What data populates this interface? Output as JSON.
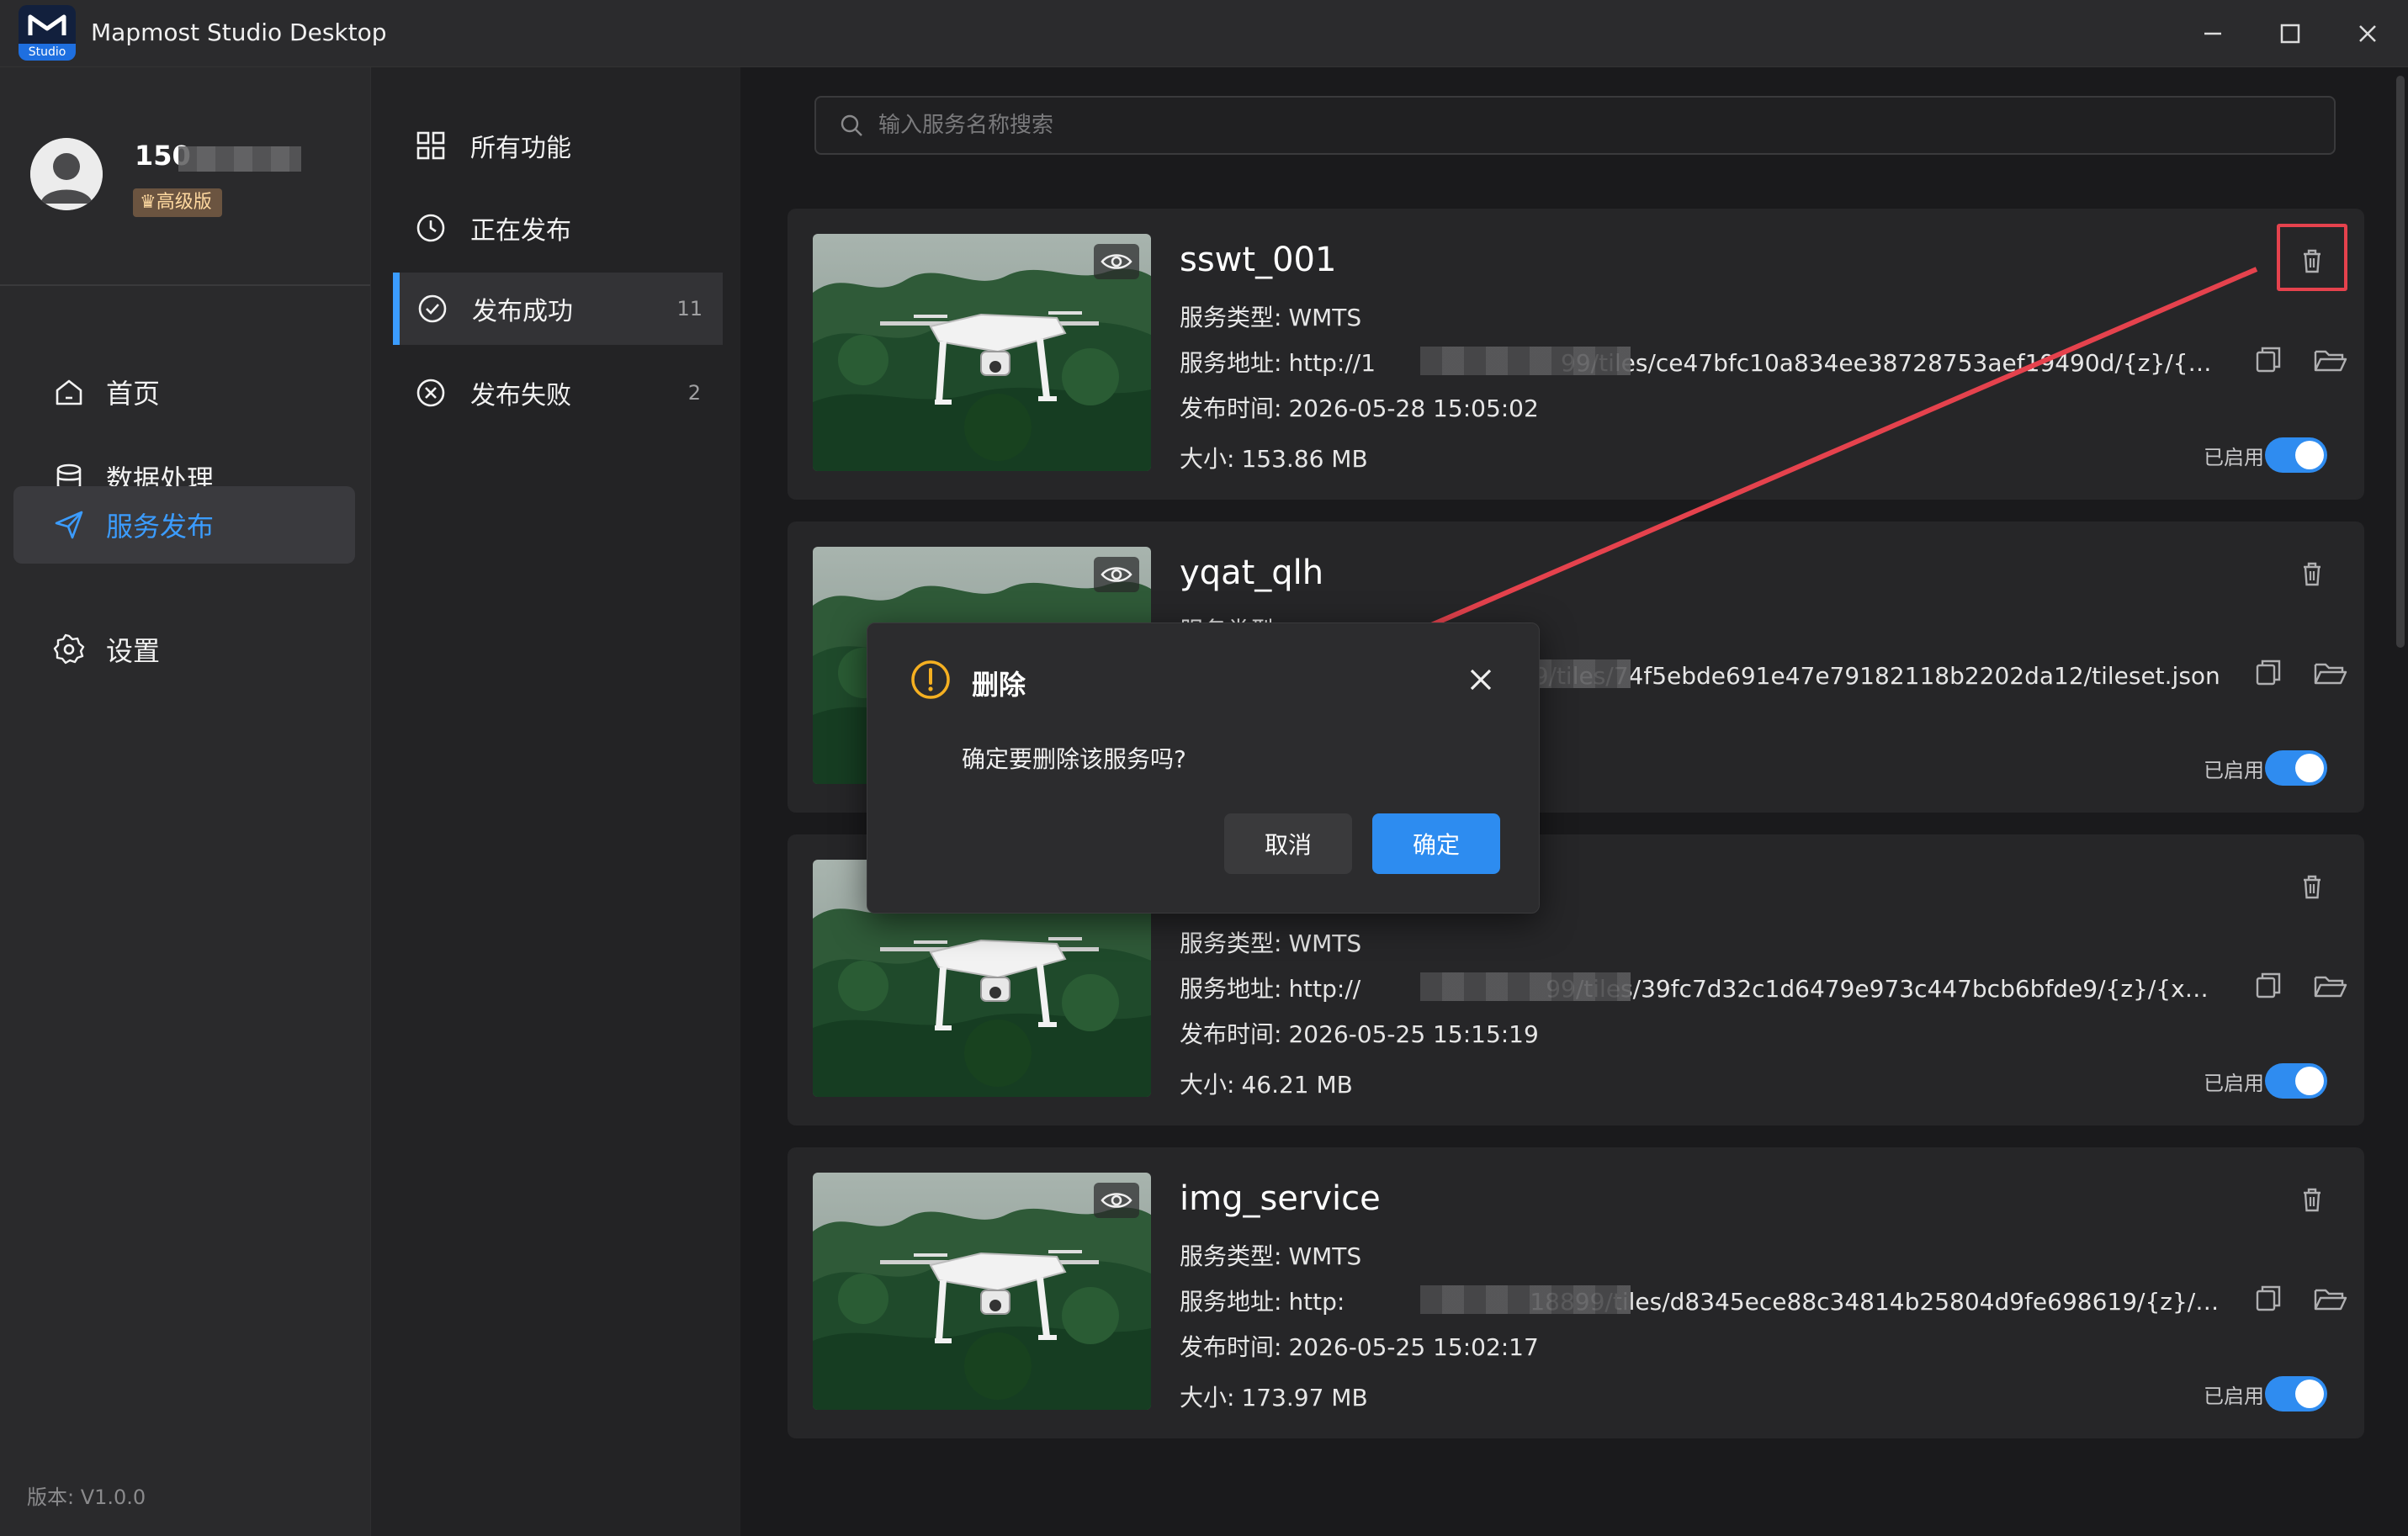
{
  "window": {
    "app_title": "Mapmost Studio Desktop",
    "logo_tag": "Studio",
    "logo_mark": "M"
  },
  "user": {
    "name": "150",
    "badge": "♛高级版"
  },
  "nav": {
    "items": [
      {
        "label": "首页",
        "icon": "home-icon"
      },
      {
        "label": "数据处理",
        "icon": "database-icon"
      },
      {
        "label": "服务发布",
        "icon": "send-icon"
      },
      {
        "label": "设置",
        "icon": "gear-icon"
      }
    ],
    "active_index": 2
  },
  "version": "版本: V1.0.0",
  "subnav": {
    "items": [
      {
        "label": "所有功能",
        "count": ""
      },
      {
        "label": "正在发布",
        "count": ""
      },
      {
        "label": "发布成功",
        "count": "11"
      },
      {
        "label": "发布失败",
        "count": "2"
      }
    ],
    "active_index": 2
  },
  "search": {
    "placeholder": "输入服务名称搜索"
  },
  "labels": {
    "type": "服务类型:",
    "url": "服务地址:",
    "time": "发布时间:",
    "size": "大小:",
    "enabled": "已启用"
  },
  "services": [
    {
      "name": "sswt_001",
      "type": "WMTS",
      "url_prefix": "http://1",
      "url_suffix": "99/tiles/ce47bfc10a834ee38728753aef19490d/{z}/{x}/{y}.…",
      "time": "2026-05-28 15:05:02",
      "size": "153.86 MB",
      "enabled": true
    },
    {
      "name": "yqat_qlh",
      "type": "",
      "url_prefix": "",
      "url_suffix": "18899/tiles/74f5ebde691e47e79182118b2202da12/tileset.json",
      "time": "",
      "size": "",
      "enabled": true
    },
    {
      "name": "",
      "type": "WMTS",
      "url_prefix": "http://",
      "url_suffix": "99/tiles/39fc7d32c1d6479e973c447bcb6bfde9/{z}/{x}/{y}.…",
      "time": "2026-05-25 15:15:19",
      "size": "46.21 MB",
      "enabled": true
    },
    {
      "name": "img_service",
      "type": "WMTS",
      "url_prefix": "http:",
      "url_suffix": "18899/tiles/d8345ece88c34814b25804d9fe698619/{z}/{x}/{y}…",
      "time": "2026-05-25 15:02:17",
      "size": "173.97 MB",
      "enabled": true
    }
  ],
  "dialog": {
    "title": "删除",
    "message": "确定要删除该服务吗?",
    "cancel": "取消",
    "confirm": "确定"
  },
  "colors": {
    "accent": "#2d8cf0",
    "highlight": "#e5424d",
    "warning": "#f5b021"
  }
}
